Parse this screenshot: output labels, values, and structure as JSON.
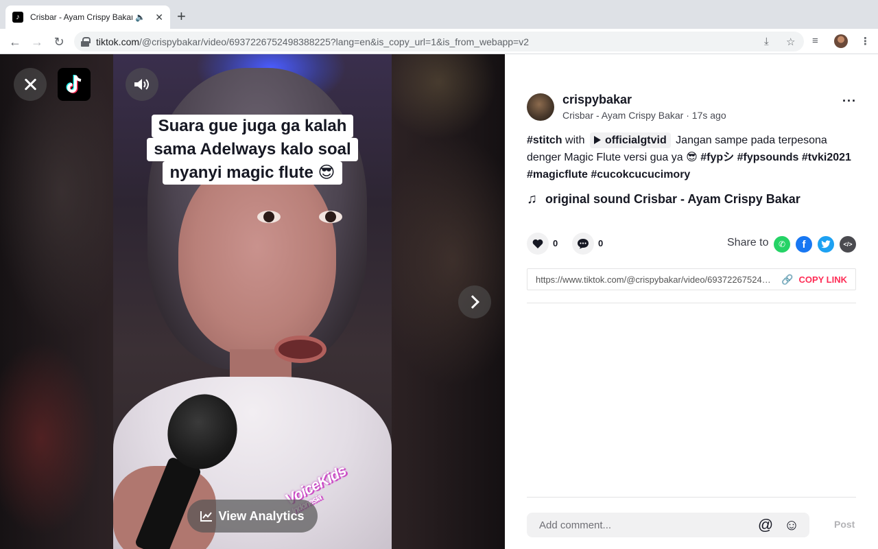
{
  "browser": {
    "tab_title": "Crisbar - Ayam Crispy Bakar",
    "new_tab_symbol": "+",
    "url_main": "tiktok.com",
    "url_rest": "/@crispybakar/video/6937226752498388225?lang=en&is_copy_url=1&is_from_webapp=v2"
  },
  "video": {
    "caption_lines": [
      "Suara gue juga ga kalah",
      "sama Adelways kalo soal",
      "nyanyi magic flute 😎"
    ],
    "view_analytics_label": "View Analytics",
    "overlay_logo_line1": "VoiceKids",
    "overlay_logo_line2": "Indonesia"
  },
  "post": {
    "username": "crispybakar",
    "nickname": "Crisbar - Ayam Crispy Bakar",
    "separator": "·",
    "time_ago": "17s ago",
    "desc_tag_stitch": "#stitch",
    "desc_with": "with",
    "desc_chip": "officialgtvid",
    "desc_text": "Jangan sampe pada terpesona denger Magic Flute versi gua ya 😎",
    "hashtags": [
      "#fypシ",
      "#fypsounds",
      "#tvki2021",
      "#magicflute",
      "#cucokcucucimory"
    ],
    "music_title": "original sound Crisbar - Ayam Crispy Bakar",
    "like_count": "0",
    "comment_count": "0",
    "share_label": "Share to",
    "link_url": "https://www.tiktok.com/@crispybakar/video/6937226752498388225",
    "copy_link_label": "COPY LINK",
    "comment_placeholder": "Add comment...",
    "post_label": "Post"
  },
  "colors": {
    "accent": "#fe2c55",
    "whatsapp": "#25d366",
    "facebook": "#1877f2",
    "twitter": "#1da1f2",
    "embed": "#4a4a4f"
  }
}
